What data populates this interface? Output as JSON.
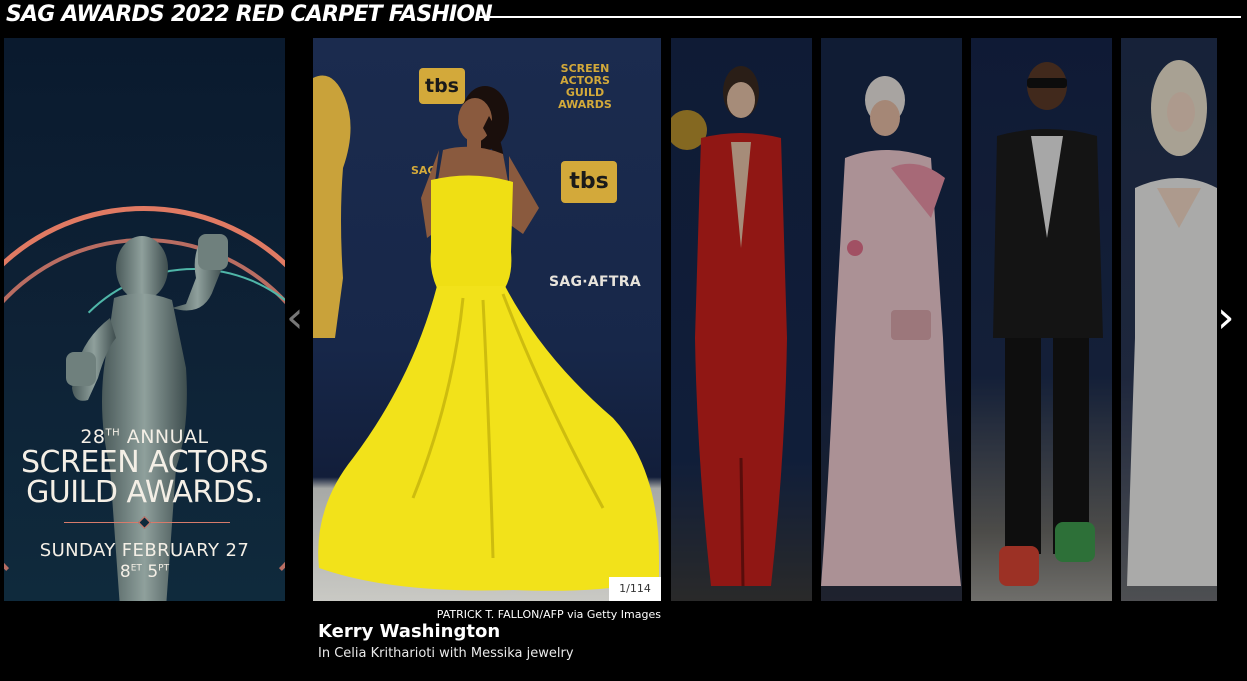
{
  "header": {
    "title": "SAG AWARDS 2022 RED CARPET FASHION"
  },
  "promo": {
    "annual_number": "28",
    "annual_suffix": "TH",
    "annual_word": "ANNUAL",
    "line1": "SCREEN ACTORS",
    "line2": "GUILD AWARDS.",
    "date": "SUNDAY FEBRUARY 27",
    "time_et": "8",
    "time_et_label": "ET",
    "time_pt": "5",
    "time_pt_label": "PT"
  },
  "featured": {
    "backdrop": {
      "tbs_top": "tbs",
      "tbs_mid": "tbs",
      "sag_logo": "SCREEN ACTORS GUILD AWARDS",
      "sag_small": "SAG",
      "sag_aftra": "SAG·AFTRA"
    },
    "counter": "1/114",
    "credit": "PATRICK T. FALLON/AFP via Getty Images",
    "name": "Kerry Washington",
    "description": "In Celia Kritharioti with Messika jewelry"
  },
  "nav": {
    "prev_icon": "chevron-left-icon",
    "next_icon": "chevron-right-icon",
    "prev_glyph": "‹",
    "next_glyph": "›"
  },
  "colors": {
    "background": "#000000",
    "accent_coral": "#e07a63",
    "gold": "#d3a93a",
    "dress_yellow": "#f2e21a",
    "dress_red": "#c8201c"
  }
}
